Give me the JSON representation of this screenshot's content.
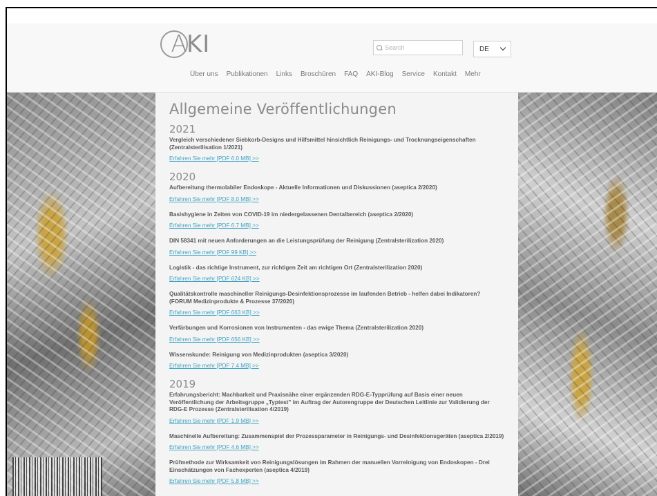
{
  "header": {
    "logo": {
      "letter": "A",
      "rest": "KI"
    },
    "search": {
      "placeholder": "Search"
    },
    "language": {
      "selected": "DE"
    },
    "nav": [
      "Über uns",
      "Publikationen",
      "Links",
      "Broschüren",
      "FAQ",
      "AKI-Blog",
      "Service",
      "Kontakt",
      "Mehr"
    ]
  },
  "main": {
    "page_title": "Allgemeine Veröffentlichungen",
    "years": [
      {
        "year": "2021",
        "entries": [
          {
            "title": "Vergleich verschiedener Siebkorb-Designs und Hilfsmittel hinsichtlich Reinigungs- und Trocknungseigenschaften (Zentralsterilisation 1/2021)",
            "link": "Erfahren Sie mehr [PDF 6.0 MB] >>"
          }
        ]
      },
      {
        "year": "2020",
        "entries": [
          {
            "title": "Aufbereitung thermolabiler Endoskope - Aktuelle Informationen und Diskussionen (aseptica 2/2020)",
            "link": "Erfahren Sie mehr [PDF 8.0 MB] >>"
          },
          {
            "title": "Basishygiene in Zeiten von COVID-19 im niedergelassenen Dentalbereich (aseptica 2/2020)",
            "link": "Erfahren Sie mehr [PDF 6.7 MB] >>"
          },
          {
            "title": "DIN 58341 mit neuen Anforderungen an die Leistungsprüfung der Reinigung (Zentralsterilization 2020)",
            "link": "Erfahren Sie mehr [PDF 99 KB] >>"
          },
          {
            "title": "Logistik - das richtige Instrument, zur richtigen Zeit am richtigen Ort (Zentralsterilization 2020)",
            "link": "Erfahren Sie mehr [PDF 624 KB] >>"
          },
          {
            "title": "Qualitätskontrolle maschineller Reinigungs-Desinfektionsprozesse im laufenden Betrieb - helfen dabei Indikatoren? (FORUM Medizinprodukte & Prozesse 37/2020)",
            "link": "Erfahren Sie mehr [PDF 663 KB] >>"
          },
          {
            "title": "Verfärbungen und Korrosionen von Instrumenten - das ewige Thema (Zentralsterilization 2020)",
            "link": "Erfahren Sie mehr [PDF 656 KB] >>"
          },
          {
            "title": "Wissenskunde: Reinigung von Medizinprodukten (aseptica 3/2020)",
            "link": "Erfahren Sie mehr [PDF 7.4 MB] >>"
          }
        ]
      },
      {
        "year": "2019",
        "entries": [
          {
            "title": "Erfahrungsbericht: Machbarkeit und Praxisnähe einer ergänzenden RDG-E-Typprüfung auf Basis einer neuen Veröffentlichung der Arbeitsgruppe „Typtest\" im Auftrag der Autorengruppe der Deutschen Leitlinie zur Validierung der RDG-E Prozesse (Zentralsterilisation 4/2019)",
            "link": "Erfahren Sie mehr [PDF 1.9 MB] >>"
          },
          {
            "title": "Maschinelle Aufbereitung: Zusammenspiel der Prozessparameter in Reinigungs- und Desinfektionsgeräten (aseptica 2/2019)",
            "link": "Erfahren Sie mehr [PDF 4.6 MB] >>"
          },
          {
            "title": "Prüfmethode zur Wirksamkeit von Reinigungslösungen im Rahmen der manuellen Vorreinigung von Endoskopen - Drei Einschätzungen von Fachexperten (aseptica 4/2019)",
            "link": "Erfahren Sie mehr [PDF 5.8 MB] >>"
          }
        ]
      }
    ]
  }
}
